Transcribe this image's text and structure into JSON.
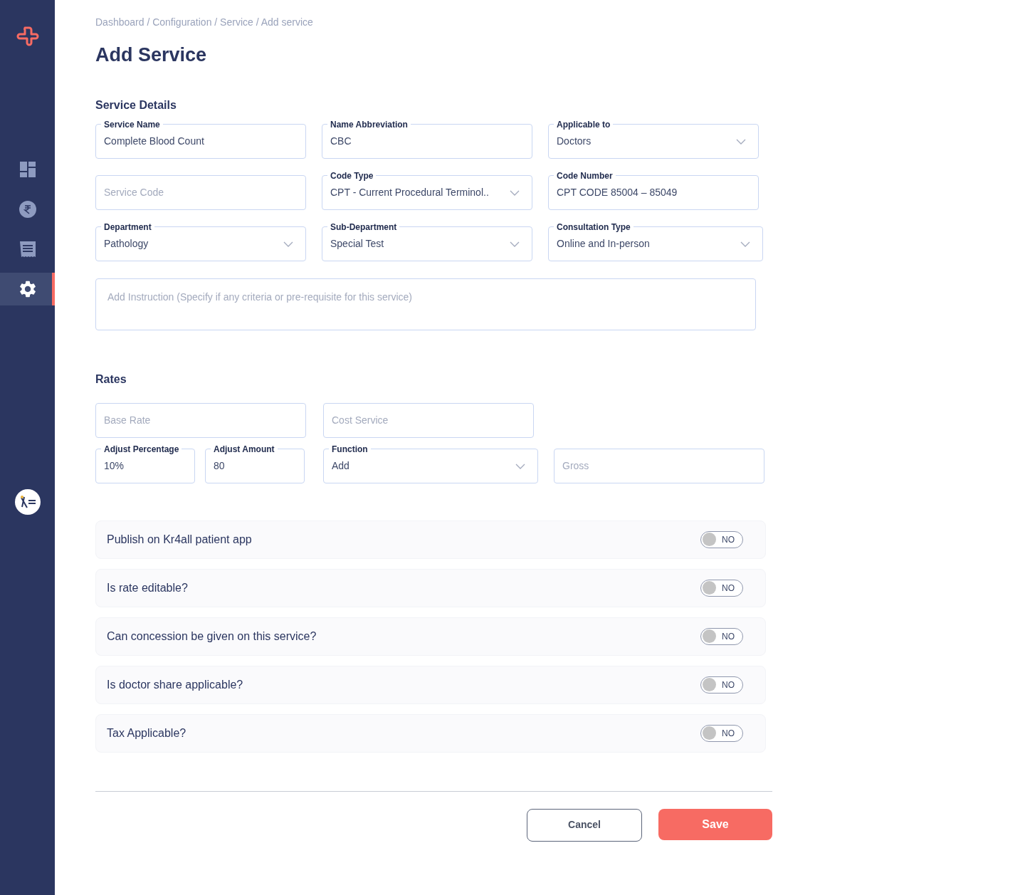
{
  "sidebar": {
    "items": [
      {
        "kind": "dashboard",
        "selected": false
      },
      {
        "kind": "rupee",
        "selected": false
      },
      {
        "kind": "receipt",
        "selected": false
      },
      {
        "kind": "settings",
        "selected": true
      }
    ]
  },
  "breadcrumb": "Dashboard / Configuration / Service / Add service",
  "title": "Add Service",
  "service_details": {
    "heading": "Service Details",
    "rows": [
      [
        {
          "kind": "text",
          "label": "Service Name",
          "value": "Complete Blood Count"
        },
        {
          "kind": "text",
          "label": "Name Abbreviation",
          "value": "CBC"
        },
        {
          "kind": "select",
          "label": "Applicable to",
          "value": "Doctors"
        }
      ],
      [
        {
          "kind": "text",
          "placeholder": "Service Code"
        },
        {
          "kind": "select",
          "label": "Code Type",
          "value": "CPT - Current Procedural Terminol.."
        },
        {
          "kind": "text",
          "label": "Code Number",
          "value": "CPT CODE 85004 – 85049"
        }
      ],
      [
        {
          "kind": "select",
          "label": "Department",
          "value": "Pathology"
        },
        {
          "kind": "select",
          "label": "Sub-Department",
          "value": "Special Test"
        },
        {
          "kind": "select",
          "label": "Consultation Type",
          "value": "Online and In-person"
        }
      ]
    ],
    "instruction": {
      "placeholder": "Add Instruction (Specify if any criteria or pre-requisite for this service)"
    }
  },
  "rates": {
    "heading": "Rates",
    "row_1": [
      {
        "kind": "text",
        "placeholder": "Base Rate"
      },
      {
        "kind": "text",
        "placeholder": "Cost Service"
      }
    ],
    "row_2": [
      {
        "kind": "text",
        "label": "Adjust Percentage",
        "value": "10%"
      },
      {
        "kind": "text",
        "label": "Adjust Amount",
        "value": "80"
      },
      {
        "kind": "select",
        "label": "Function",
        "value": "Add"
      },
      {
        "kind": "text",
        "placeholder": "Gross"
      }
    ]
  },
  "options": [
    {
      "label": "Publish on Kr4all patient app",
      "on": false,
      "state_text": "NO"
    },
    {
      "label": "Is rate editable?",
      "on": false,
      "state_text": "NO"
    },
    {
      "label": "Can concession be given on this service?",
      "on": false,
      "state_text": "NO"
    },
    {
      "label": "Is doctor share applicable?",
      "on": false,
      "state_text": "NO"
    },
    {
      "label": "Tax Applicable?",
      "on": false,
      "state_text": "NO"
    }
  ],
  "buttons": {
    "cancel": "Cancel",
    "save": "Save"
  }
}
